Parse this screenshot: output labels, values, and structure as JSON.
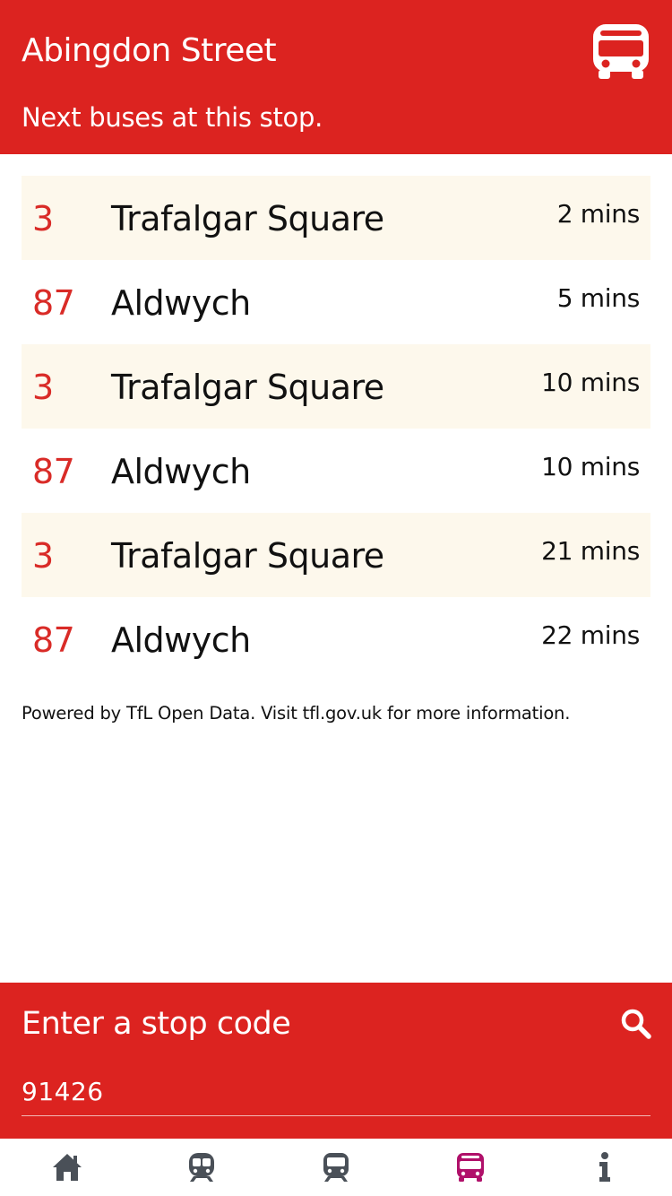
{
  "header": {
    "title": "Abingdon Street",
    "subtitle": "Next buses at this stop.",
    "icon": "bus-icon"
  },
  "arrivals": [
    {
      "route": "3",
      "destination": "Trafalgar Square",
      "eta": "2 mins"
    },
    {
      "route": "87",
      "destination": "Aldwych",
      "eta": "5 mins"
    },
    {
      "route": "3",
      "destination": "Trafalgar Square",
      "eta": "10 mins"
    },
    {
      "route": "87",
      "destination": "Aldwych",
      "eta": "10 mins"
    },
    {
      "route": "3",
      "destination": "Trafalgar Square",
      "eta": "21 mins"
    },
    {
      "route": "87",
      "destination": "Aldwych",
      "eta": "22 mins"
    }
  ],
  "attribution": "Powered by TfL Open Data. Visit tfl.gov.uk for more information.",
  "search": {
    "label": "Enter a stop code",
    "value": "91426",
    "icon": "search-icon"
  },
  "tabbar": {
    "items": [
      {
        "name": "home",
        "icon": "home-icon",
        "active": false
      },
      {
        "name": "tube",
        "icon": "tube-train-icon",
        "active": false
      },
      {
        "name": "rail",
        "icon": "rail-train-icon",
        "active": false
      },
      {
        "name": "bus",
        "icon": "bus-icon",
        "active": true
      },
      {
        "name": "info",
        "icon": "info-icon",
        "active": false
      }
    ]
  },
  "colors": {
    "brand_red": "#dc2320",
    "route_red": "#d92b27",
    "alt_row": "#fdf8ec",
    "tab_inactive": "#4a5058",
    "tab_active": "#b0106a"
  }
}
